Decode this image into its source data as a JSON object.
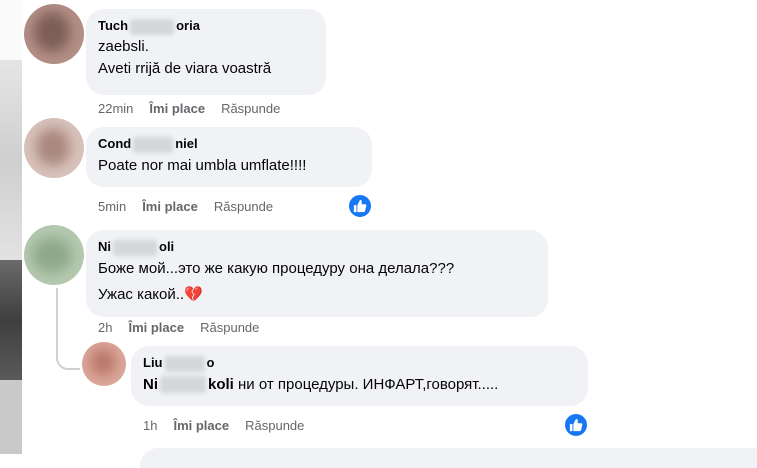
{
  "comments": [
    {
      "author_start": "Tuch",
      "author_end": "oria",
      "lines": [
        "zaebsli.",
        "Aveti rrijă de viara voastră"
      ],
      "time": "22min",
      "like": "Îmi place",
      "reply": "Răspunde"
    },
    {
      "author_start": "Cond",
      "author_end": "niel",
      "lines": [
        "Poate nor mai umbla umflate!!!!"
      ],
      "time": "5min",
      "like": "Îmi place",
      "reply": "Răspunde"
    },
    {
      "author_start": "Ni",
      "author_end": "oli",
      "lines": [
        "Боже мой...это же какую процедуру она делала???",
        "Ужас какой..💔"
      ],
      "time": "2h",
      "like": "Îmi place",
      "reply": "Răspunde"
    }
  ],
  "reply": {
    "author_start": "Liu",
    "author_end": "o",
    "mention_start": "Ni",
    "mention_end": "koli",
    "text": " ни от процедуры. ИНФАРТ,говорят.....",
    "time": "1h",
    "like": "Îmi place",
    "reply": "Răspunde"
  },
  "icons": {
    "reaction": "like-thumb-icon"
  },
  "colors": {
    "bubble": "#f0f2f5",
    "like_blue": "#1877f2",
    "meta": "#65676b"
  }
}
